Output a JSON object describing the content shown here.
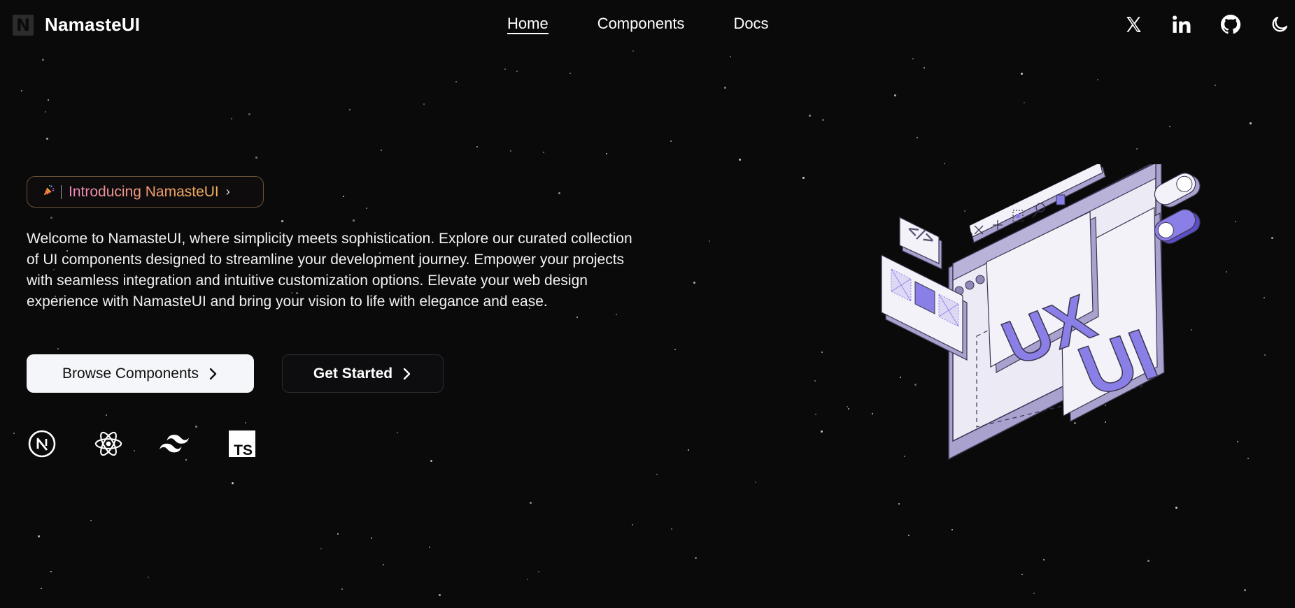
{
  "brand": {
    "logo_letter": "N",
    "name": "NamasteUI"
  },
  "nav": {
    "links": [
      {
        "label": "Home",
        "active": true
      },
      {
        "label": "Components",
        "active": false
      },
      {
        "label": "Docs",
        "active": false
      }
    ]
  },
  "social": {
    "icons": [
      "x-icon",
      "linkedin-icon",
      "github-icon",
      "moon-icon"
    ]
  },
  "hero": {
    "badge": {
      "icon": "party-popper-icon",
      "text": "Introducing NamasteUI",
      "chevron": "›"
    },
    "description": "Welcome to NamasteUI, where simplicity meets sophistication. Explore our curated collection of UI components designed to streamline your development journey. Empower your projects with seamless integration and intuitive customization options. Elevate your web design experience with NamasteUI and bring your vision to life with elegance and ease.",
    "primary_button": "Browse Components",
    "secondary_button": "Get Started",
    "tech_icons": [
      "nextjs-icon",
      "react-icon",
      "tailwind-icon",
      "typescript-icon"
    ],
    "typescript_label": "TS",
    "illustration": {
      "labels": {
        "ux": "UX",
        "ui": "UI",
        "code": "</>"
      },
      "colors": {
        "panel": "#ecebf5",
        "edge": "#a9a2cf",
        "accent": "#8a7fe6",
        "stroke": "#3a3550"
      }
    }
  },
  "colors": {
    "background": "#0b0a0b",
    "text": "#ffffff",
    "badge_gradient_start": "#f08abf",
    "badge_gradient_end": "#f7b35a"
  }
}
